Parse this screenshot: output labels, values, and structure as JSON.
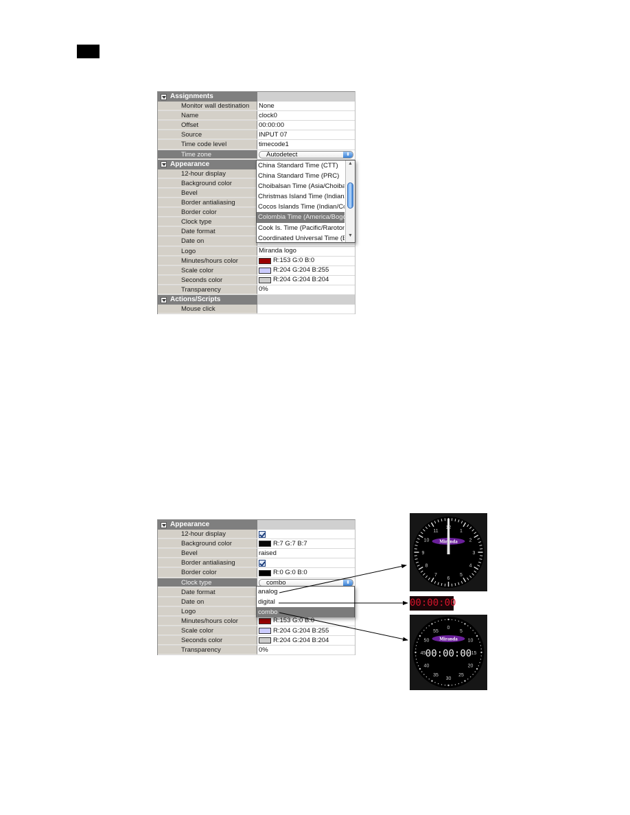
{
  "page_marker": "",
  "panel1": {
    "sections": {
      "assignments": "Assignments",
      "appearance": "Appearance",
      "actions": "Actions/Scripts"
    },
    "assignments": [
      {
        "key": "Monitor wall destination",
        "value": "None"
      },
      {
        "key": "Name",
        "value": "clock0"
      },
      {
        "key": "Offset",
        "value": "00:00:00"
      },
      {
        "key": "Source",
        "value": "INPUT 07"
      },
      {
        "key": "Time code level",
        "value": "timecode1"
      },
      {
        "key": "Time zone",
        "value": "Autodetect"
      }
    ],
    "appearance": [
      {
        "key": "12-hour display"
      },
      {
        "key": "Background color"
      },
      {
        "key": "Bevel"
      },
      {
        "key": "Border antialiasing"
      },
      {
        "key": "Border color"
      },
      {
        "key": "Clock type"
      },
      {
        "key": "Date format"
      },
      {
        "key": "Date on"
      },
      {
        "key": "Logo",
        "value": "Miranda logo"
      },
      {
        "key": "Minutes/hours color",
        "value": "R:153 G:0 B:0",
        "color": "#990000"
      },
      {
        "key": "Scale color",
        "value": "R:204 G:204 B:255",
        "color": "#ccccff"
      },
      {
        "key": "Seconds color",
        "value": "R:204 G:204 B:204",
        "color": "#cccccc"
      },
      {
        "key": "Transparency",
        "value": "0%"
      }
    ],
    "actions": [
      {
        "key": "Mouse click",
        "value": ""
      }
    ],
    "timezone_dropdown": {
      "items": [
        "China Standard Time (CTT)",
        "China Standard Time (PRC)",
        "Choibalsan Time (Asia/Choibalsan)",
        "Christmas Island Time (Indian/Christmas)",
        "Cocos Islands Time (Indian/Cocos)",
        "Colombia Time (America/Bogota)",
        "Cook Is. Time (Pacific/Rarotonga)",
        "Coordinated Universal Time (Etc/UTC)"
      ],
      "highlighted": "Colombia Time (America/Bogota)"
    }
  },
  "panel2": {
    "section": "Appearance",
    "rows": [
      {
        "key": "12-hour display",
        "checked": true
      },
      {
        "key": "Background color",
        "value": "R:7 G:7 B:7",
        "color": "#070707"
      },
      {
        "key": "Bevel",
        "value": "raised"
      },
      {
        "key": "Border antialiasing",
        "checked": true
      },
      {
        "key": "Border color",
        "value": "R:0 G:0 B:0",
        "color": "#000000"
      },
      {
        "key": "Clock type",
        "value": "combo"
      },
      {
        "key": "Date format",
        "value": ""
      },
      {
        "key": "Date on",
        "value": ""
      },
      {
        "key": "Logo",
        "value": ""
      },
      {
        "key": "Minutes/hours color",
        "value": "R:153 G:0 B:0",
        "color": "#990000"
      },
      {
        "key": "Scale color",
        "value": "R:204 G:204 B:255",
        "color": "#ccccff"
      },
      {
        "key": "Seconds color",
        "value": "R:204 G:204 B:204",
        "color": "#cccccc"
      },
      {
        "key": "Transparency",
        "value": "0%"
      }
    ],
    "clocktype_dropdown": {
      "items": [
        "analog",
        "digital",
        "combo"
      ],
      "highlighted": "combo"
    }
  },
  "clocks": {
    "logo_text": "Miranda",
    "digital_time": "00:00:00",
    "combo_time": "00:00:00",
    "analog_numbers": [
      "12",
      "1",
      "2",
      "3",
      "4",
      "5",
      "6",
      "7",
      "8",
      "9",
      "10",
      "11"
    ],
    "combo_numbers": [
      "0",
      "5",
      "10",
      "15",
      "20",
      "25",
      "30",
      "35",
      "40",
      "45",
      "50",
      "55"
    ]
  }
}
